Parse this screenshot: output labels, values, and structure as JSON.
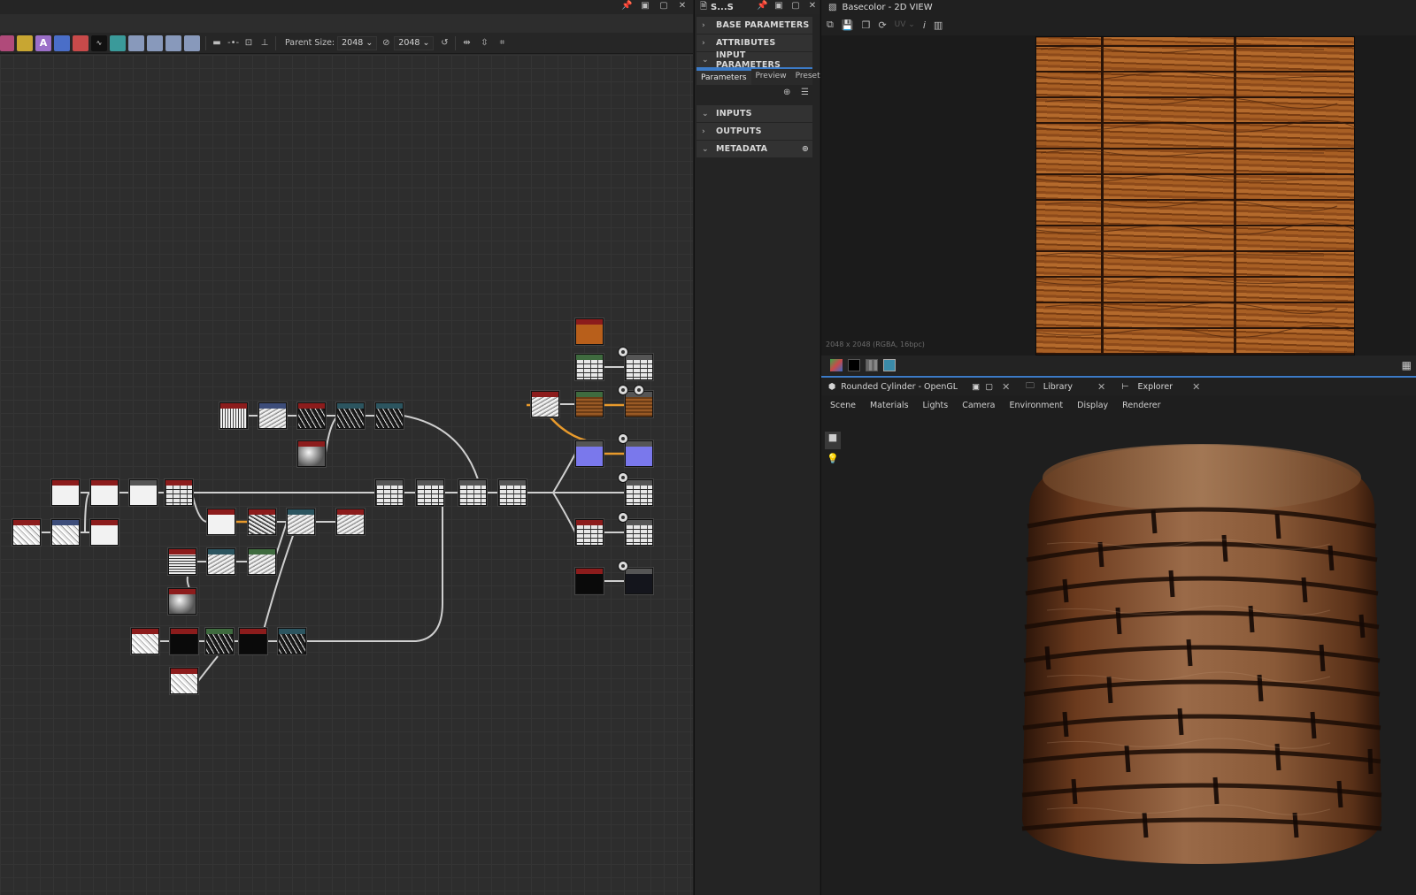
{
  "graph": {
    "toolbar": {
      "parent_size_label": "Parent Size:",
      "parent_size_a": "2048",
      "parent_size_b": "2048"
    }
  },
  "params": {
    "title": "S...S",
    "sections": {
      "base": "BASE PARAMETERS",
      "attributes": "ATTRIBUTES",
      "input_parameters": "INPUT PARAMETERS",
      "inputs": "INPUTS",
      "outputs": "OUTPUTS",
      "metadata": "METADATA"
    },
    "tabs": {
      "parameters": "Parameters",
      "preview": "Preview",
      "presets": "Presets"
    }
  },
  "view2d": {
    "title": "Basecolor - 2D VIEW",
    "uv_label": "UV",
    "texture_info": "2048 x 2048 (RGBA, 16bpc)"
  },
  "view3d": {
    "tabs": {
      "viewport": "Rounded Cylinder - OpenGL",
      "library": "Library",
      "explorer": "Explorer"
    },
    "menu": {
      "scene": "Scene",
      "materials": "Materials",
      "lights": "Lights",
      "camera": "Camera",
      "environment": "Environment",
      "display": "Display",
      "renderer": "Renderer"
    }
  },
  "colors": {
    "accent": "#3c7bc7",
    "wire_active": "#e89a2c",
    "wire": "#cfcfcf",
    "node_header_red": "#8c1c1c"
  },
  "nodes": [
    {
      "id": "n1",
      "tex": "t-white",
      "hdr": "hdr-red"
    },
    {
      "id": "n2",
      "tex": "t-white",
      "hdr": "hdr-red"
    },
    {
      "id": "n3",
      "tex": "t-white",
      "hdr": "hdr-gray"
    },
    {
      "id": "n4",
      "tex": "t-brick",
      "hdr": "hdr-red"
    },
    {
      "id": "n5",
      "tex": "t-noise",
      "hdr": "hdr-red"
    },
    {
      "id": "n6",
      "tex": "t-noise",
      "hdr": "hdr-blue"
    },
    {
      "id": "n7",
      "tex": "t-white",
      "hdr": "hdr-red"
    },
    {
      "id": "n8",
      "tex": "t-vstripes",
      "hdr": "hdr-red"
    },
    {
      "id": "n9",
      "tex": "t-noise2",
      "hdr": "hdr-blue"
    },
    {
      "id": "n10",
      "tex": "t-black-noise",
      "hdr": "hdr-red"
    },
    {
      "id": "n11",
      "tex": "t-black-noise",
      "hdr": "hdr-teal"
    },
    {
      "id": "n12",
      "tex": "t-black-noise",
      "hdr": "hdr-teal"
    },
    {
      "id": "n13",
      "tex": "t-blur",
      "hdr": "hdr-red"
    },
    {
      "id": "n14",
      "tex": "t-white",
      "hdr": "hdr-red"
    },
    {
      "id": "n15",
      "tex": "t-mix",
      "hdr": "hdr-red"
    },
    {
      "id": "n16",
      "tex": "t-noise2",
      "hdr": "hdr-teal"
    },
    {
      "id": "n17",
      "tex": "t-noise2",
      "hdr": "hdr-red"
    },
    {
      "id": "n18",
      "tex": "t-stripes",
      "hdr": "hdr-red"
    },
    {
      "id": "n19",
      "tex": "t-noise2",
      "hdr": "hdr-teal"
    },
    {
      "id": "n20",
      "tex": "t-noise2",
      "hdr": "hdr-green"
    },
    {
      "id": "n21",
      "tex": "t-blur",
      "hdr": "hdr-red"
    },
    {
      "id": "n22",
      "tex": "t-noise",
      "hdr": "hdr-red"
    },
    {
      "id": "n23",
      "tex": "t-black",
      "hdr": "hdr-red"
    },
    {
      "id": "n24",
      "tex": "t-black-noise",
      "hdr": "hdr-green"
    },
    {
      "id": "n25",
      "tex": "t-black",
      "hdr": "hdr-red"
    },
    {
      "id": "n26",
      "tex": "t-black-noise",
      "hdr": "hdr-teal"
    },
    {
      "id": "n27",
      "tex": "t-noise",
      "hdr": "hdr-red"
    },
    {
      "id": "n28",
      "tex": "t-brick",
      "hdr": "hdr-gray"
    },
    {
      "id": "n29",
      "tex": "t-brick",
      "hdr": "hdr-gray"
    },
    {
      "id": "n30",
      "tex": "t-brick",
      "hdr": "hdr-gray"
    },
    {
      "id": "n31",
      "tex": "t-brick",
      "hdr": "hdr-gray"
    },
    {
      "id": "n32",
      "tex": "t-noise2",
      "hdr": "hdr-red"
    },
    {
      "id": "n33",
      "tex": "t-orange",
      "hdr": "hdr-red"
    },
    {
      "id": "n34",
      "tex": "t-brick",
      "hdr": "hdr-green"
    },
    {
      "id": "n35",
      "tex": "t-brick",
      "hdr": "hdr-gray"
    },
    {
      "id": "n36",
      "tex": "t-wood",
      "hdr": "hdr-green"
    },
    {
      "id": "n37",
      "tex": "t-wood",
      "hdr": "hdr-gray"
    },
    {
      "id": "n38",
      "tex": "t-blue",
      "hdr": "hdr-gray"
    },
    {
      "id": "n39",
      "tex": "t-blue",
      "hdr": "hdr-gray"
    },
    {
      "id": "n40",
      "tex": "t-brick",
      "hdr": "hdr-gray"
    },
    {
      "id": "n41",
      "tex": "t-brick",
      "hdr": "hdr-red"
    },
    {
      "id": "n42",
      "tex": "t-brick",
      "hdr": "hdr-gray"
    },
    {
      "id": "n43",
      "tex": "t-black",
      "hdr": "hdr-red"
    },
    {
      "id": "n44",
      "tex": "t-darkblue",
      "hdr": "hdr-gray"
    }
  ]
}
